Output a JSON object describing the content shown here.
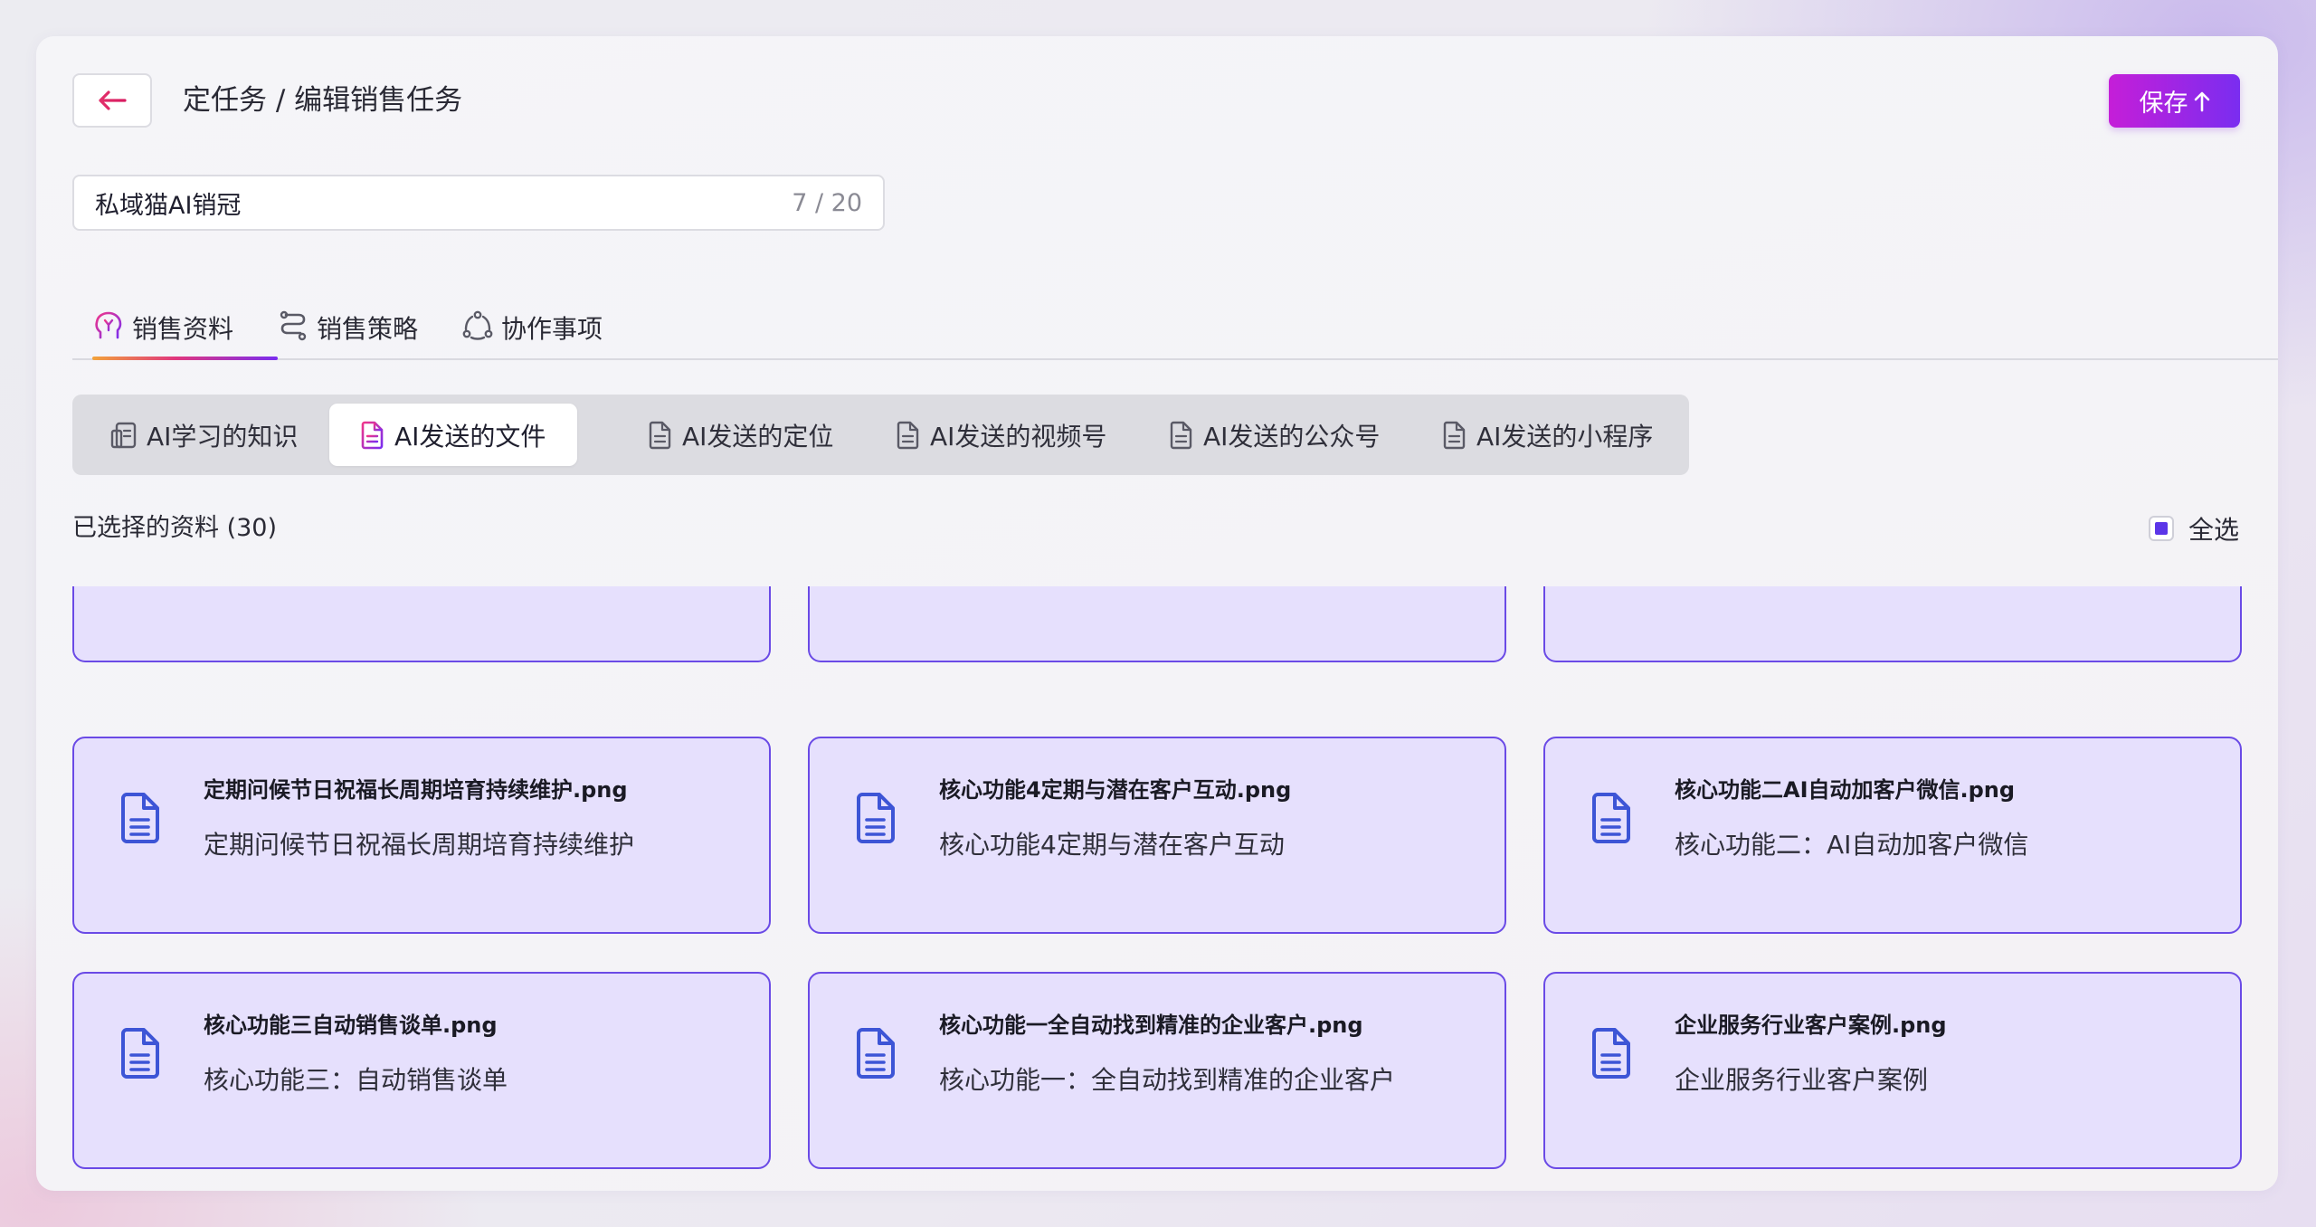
{
  "header": {
    "title": "定任务 / 编辑销售任务",
    "save_label": "保存",
    "save_icon": "arrow-up-icon",
    "back_icon": "arrow-left-icon"
  },
  "name_field": {
    "value": "私域猫AI销冠",
    "counter": "7 / 20"
  },
  "main_tabs": [
    {
      "label": "销售资料",
      "icon": "brain-head-icon",
      "active": true
    },
    {
      "label": "销售策略",
      "icon": "route-icon",
      "active": false
    },
    {
      "label": "协作事项",
      "icon": "collaboration-icon",
      "active": false
    }
  ],
  "sub_tabs": [
    {
      "label": "AI学习的知识",
      "icon": "knowledge-doc-icon",
      "active": false
    },
    {
      "label": "AI发送的文件",
      "icon": "file-icon",
      "active": true
    },
    {
      "label": "AI发送的定位",
      "icon": "file-icon",
      "active": false
    },
    {
      "label": "AI发送的视频号",
      "icon": "file-icon",
      "active": false
    },
    {
      "label": "AI发送的公众号",
      "icon": "file-icon",
      "active": false
    },
    {
      "label": "AI发送的小程序",
      "icon": "file-icon",
      "active": false
    }
  ],
  "selection": {
    "label": "已选择的资料 (30)",
    "select_all_label": "全选",
    "select_all_state": "indeterminate"
  },
  "files": [
    {
      "name": "定期问候节日祝福长周期培育持续维护.png",
      "description": "定期问候节日祝福长周期培育持续维护"
    },
    {
      "name": "核心功能4定期与潜在客户互动.png",
      "description": "核心功能4定期与潜在客户互动"
    },
    {
      "name": "核心功能二AI自动加客户微信.png",
      "description": "核心功能二：AI自动加客户微信"
    },
    {
      "name": "核心功能三自动销售谈单.png",
      "description": "核心功能三：自动销售谈单"
    },
    {
      "name": "核心功能一全自动找到精准的企业客户.png",
      "description": "核心功能一：全自动找到精准的企业客户"
    },
    {
      "name": "企业服务行业客户案例.png",
      "description": "企业服务行业客户案例"
    }
  ],
  "colors": {
    "accent_purple": "#7a2df0",
    "accent_magenta": "#c51ed8",
    "card_fill": "#e6e0fd",
    "card_border": "#6a4ae6",
    "file_icon_blue": "#3d55d6"
  }
}
